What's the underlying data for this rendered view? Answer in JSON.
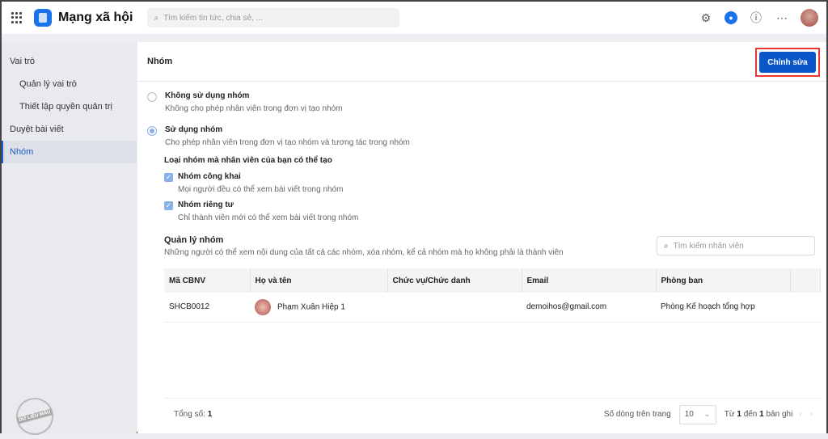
{
  "header": {
    "app_title": "Mạng xã hội",
    "search_placeholder": "Tìm kiếm tin tức, chia sẻ, ..."
  },
  "sidebar": {
    "items": [
      {
        "label": "Vai trò"
      },
      {
        "label": "Quản lý vai trò"
      },
      {
        "label": "Thiết lập quyền quản trị"
      },
      {
        "label": "Duyệt bài viết"
      },
      {
        "label": "Nhóm"
      }
    ],
    "watermark": "DỮ LIỆU MẪU"
  },
  "main": {
    "title": "Nhóm",
    "edit_label": "Chỉnh sửa",
    "options": [
      {
        "title": "Không sử dụng nhóm",
        "desc": "Không cho phép nhân viên trong đơn vị tạo nhóm",
        "selected": false
      },
      {
        "title": "Sử dụng nhóm",
        "desc": "Cho phép nhân viên trong đơn vị tạo nhóm và tương tác trong nhóm",
        "selected": true
      }
    ],
    "types_label": "Loại nhóm mà nhân viên của bạn có thể tạo",
    "types": [
      {
        "title": "Nhóm công khai",
        "desc": "Mọi người đều có thể xem bài viết trong nhóm",
        "checked": true
      },
      {
        "title": "Nhóm riêng tư",
        "desc": "Chỉ thành viên mới có thể xem bài viết trong nhóm",
        "checked": true
      }
    ],
    "manage_title": "Quản lý nhóm",
    "manage_desc": "Những người có thể xem nội dung của tất cả các nhóm, xóa nhóm, kể cả nhóm mà họ không phải là thành viên",
    "employee_search_placeholder": "Tìm kiếm nhân viên",
    "table": {
      "headers": [
        "Mã CBNV",
        "Họ và tên",
        "Chức vụ/Chức danh",
        "Email",
        "Phòng ban"
      ],
      "rows": [
        {
          "code": "SHCB0012",
          "name": "Phạm Xuân Hiệp 1",
          "position": "",
          "email": "demoihos@gmail.com",
          "dept": "Phòng Kế hoạch tổng hợp"
        }
      ]
    },
    "footer": {
      "total_label": "Tổng số:",
      "total": "1",
      "rows_per_page_label": "Số dòng trên trang",
      "rows_per_page": "10",
      "range_from_label": "Từ",
      "from": "1",
      "range_to_label": "đến",
      "to": "1",
      "records_label": "bản ghi"
    }
  }
}
